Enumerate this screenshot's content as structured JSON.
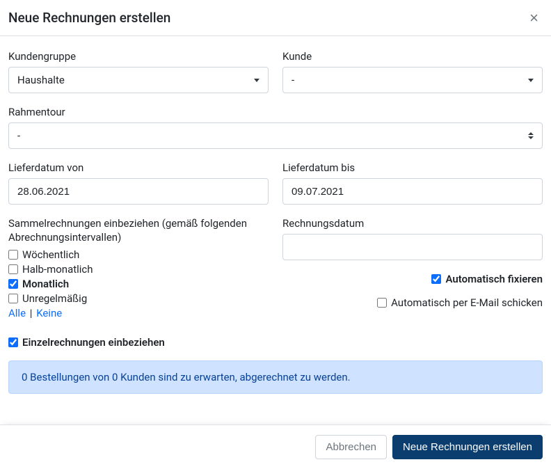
{
  "header": {
    "title": "Neue Rechnungen erstellen"
  },
  "form": {
    "kundengruppe": {
      "label": "Kundengruppe",
      "value": "Haushalte"
    },
    "kunde": {
      "label": "Kunde",
      "value": "-"
    },
    "rahmentour": {
      "label": "Rahmentour",
      "value": "-"
    },
    "lieferdatum_von": {
      "label": "Lieferdatum von",
      "value": "28.06.2021"
    },
    "lieferdatum_bis": {
      "label": "Lieferdatum bis",
      "value": "09.07.2021"
    },
    "rechnungsdatum": {
      "label": "Rechnungsdatum",
      "value": ""
    },
    "sammel_intro": "Sammelrechnungen einbeziehen (gemäß folgenden Abrechnungsintervallen)",
    "interval": {
      "woechentlich": "Wöchentlich",
      "halbmonatlich": "Halb-monatlich",
      "monatlich": "Monatlich",
      "unregelmaessig": "Unregelmäßig"
    },
    "links": {
      "alle": "Alle",
      "keine": "Keine",
      "sep": "|"
    },
    "einzel": "Einzelrechnungen einbeziehen",
    "auto_fix": "Automatisch fixieren",
    "auto_email": "Automatisch per E-Mail schicken",
    "alert": "0 Bestellungen von 0 Kunden sind zu erwarten, abgerechnet zu werden."
  },
  "footer": {
    "cancel": "Abbrechen",
    "submit": "Neue Rechnungen erstellen"
  }
}
